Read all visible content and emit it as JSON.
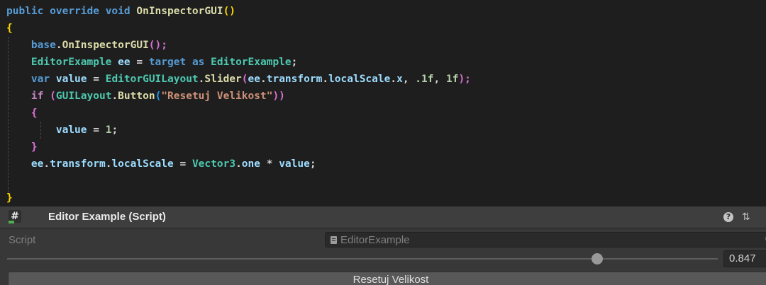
{
  "code": {
    "line_1": {
      "t1": "public",
      "t2": "override",
      "t3": "void",
      "t4": "OnInspectorGUI",
      "t5": "()"
    },
    "line_2": {
      "t1": "{"
    },
    "line_3": {
      "t1": "base",
      "t2": ".",
      "t3": "OnInspectorGUI",
      "t4": "();"
    },
    "line_4": {
      "t1": "EditorExample",
      "t2": "ee",
      "t3": " = ",
      "t4": "target",
      "t5": "as",
      "t6": "EditorExample",
      "t7": ";"
    },
    "line_5": {
      "t1": "var",
      "t2": "value",
      "t3": " = ",
      "t4": "EditorGUILayout",
      "t5": ".",
      "t6": "Slider",
      "t7": "(",
      "t8": "ee",
      "t9": ".",
      "t10": "transform",
      "t11": ".",
      "t12": "localScale",
      "t13": ".",
      "t14": "x",
      "t15": ", ",
      "t16": ".1f",
      "t17": ", ",
      "t18": "1f",
      "t19": ");"
    },
    "line_6": {
      "t1": "if",
      "t2": " (",
      "t3": "GUILayout",
      "t4": ".",
      "t5": "Button",
      "t6": "(",
      "t7": "\"Resetuj Velikost\"",
      "t8": "))"
    },
    "line_7": {
      "t1": "{"
    },
    "line_8": {
      "t1": "value",
      "t2": " = ",
      "t3": "1",
      "t4": ";"
    },
    "line_9": {
      "t1": "}"
    },
    "line_10": {
      "t1": "ee",
      "t2": ".",
      "t3": "transform",
      "t4": ".",
      "t5": "localScale",
      "t6": " = ",
      "t7": "Vector3",
      "t8": ".",
      "t9": "one",
      "t10": " * ",
      "t11": "value",
      "t12": ";"
    },
    "line_12": {
      "t1": "}"
    }
  },
  "inspector": {
    "component_title": "Editor Example (Script)",
    "script_icon_glyph": "#",
    "help_glyph": "?",
    "presets_glyph": "⇅",
    "menu_glyph": "⋮",
    "script_label": "Script",
    "script_value": "EditorExample",
    "slider_value": "0.847",
    "slider_fraction": 0.847,
    "button_label": "Resetuj Velikost"
  },
  "colors": {
    "editor_background": "#1e1e1e",
    "keyword": "#569cd6",
    "control_keyword": "#c586c0",
    "method": "#dcdcaa",
    "type": "#4ec9b0",
    "variable": "#9cdcfe",
    "string": "#ce9178",
    "number": "#b5cea8",
    "inspector_background": "#383838",
    "button_background": "#585858"
  },
  "icons": {
    "component": "script-icon",
    "help": "help-icon",
    "presets": "presets-icon",
    "menu": "kebab-menu-icon",
    "object_field": "script-file-icon",
    "object_picker": "object-picker-icon"
  }
}
